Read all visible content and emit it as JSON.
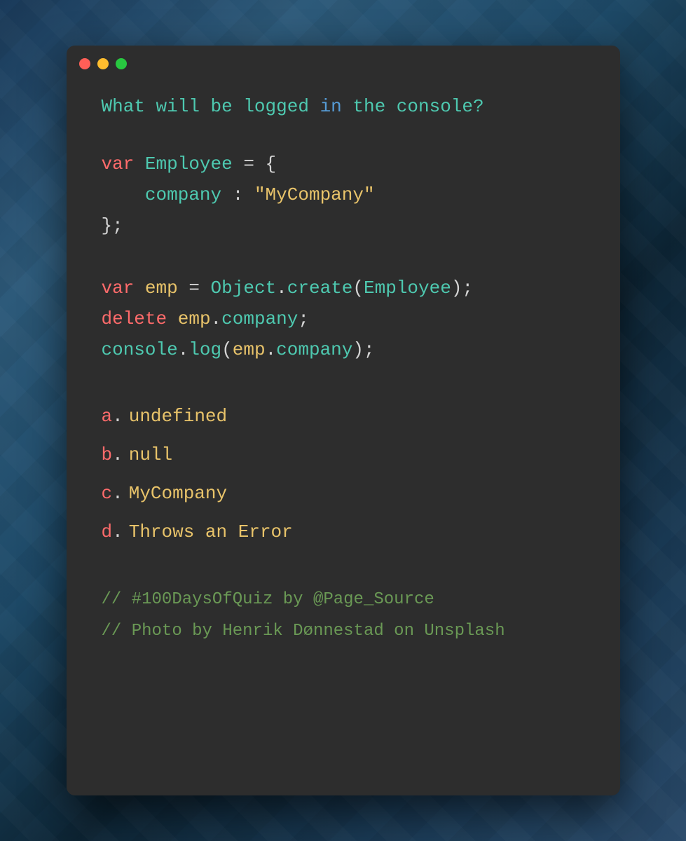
{
  "window": {
    "buttons": {
      "close_label": "close",
      "minimize_label": "minimize",
      "maximize_label": "maximize"
    }
  },
  "question": {
    "text": "What will be logged in the console?"
  },
  "code": {
    "line1": "var Employee = {",
    "line2": "    company : \"MyCompany\"",
    "line3": "};",
    "line4": "var emp = Object.create(Employee);",
    "line5": "delete emp.company;",
    "line6": "console.log(emp.company);"
  },
  "answers": {
    "a": {
      "letter": "a",
      "text": "undefined"
    },
    "b": {
      "letter": "b",
      "text": "null"
    },
    "c": {
      "letter": "c",
      "text": "MyCompany"
    },
    "d": {
      "letter": "d",
      "text": "Throws an Error"
    }
  },
  "comments": {
    "quiz": "// #100DaysOfQuiz by @Page_Source",
    "photo": "// Photo by Henrik Dønnestad on Unsplash"
  },
  "colors": {
    "red": "#ff5f57",
    "yellow": "#ffbd2e",
    "green": "#28c840",
    "background": "#2d2d2d",
    "keyword": "#ff6b6b",
    "teal": "#4ec9b0",
    "gold": "#e8c36a",
    "blue": "#569cd6",
    "comment": "#6a9955"
  }
}
